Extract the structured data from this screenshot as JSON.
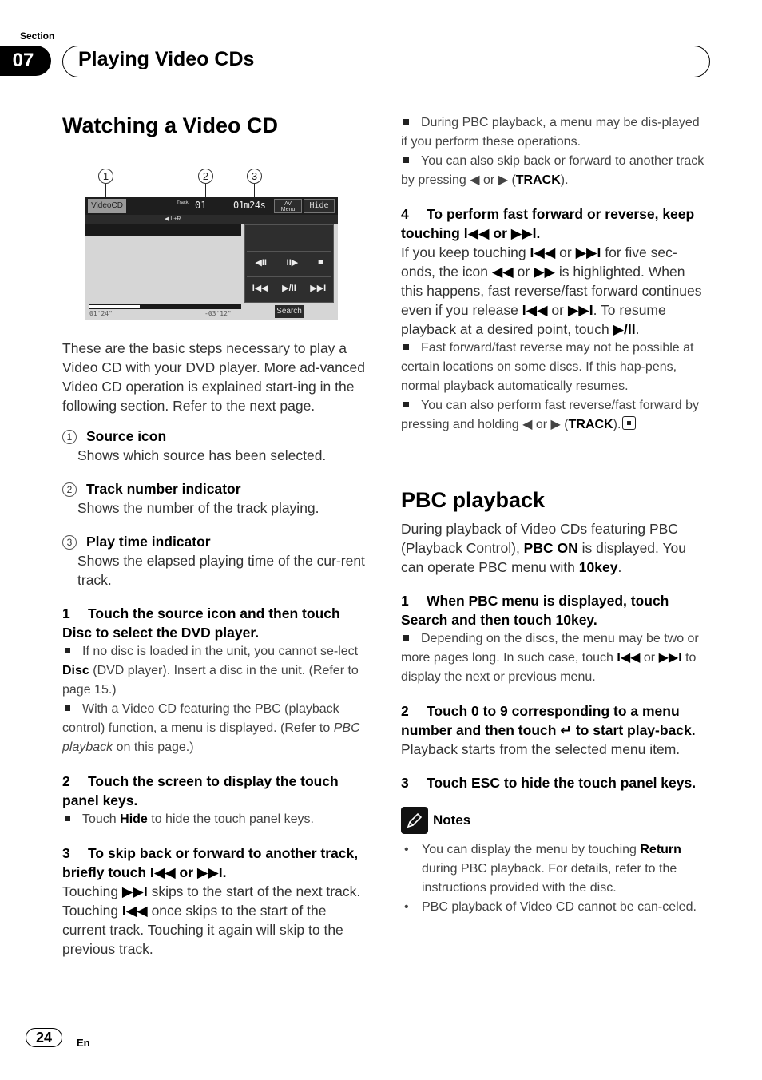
{
  "header": {
    "section_label": "Section",
    "section_number": "07",
    "section_title": "Playing Video CDs"
  },
  "left": {
    "title": "Watching a Video CD",
    "figure": {
      "callouts": [
        "1",
        "2",
        "3"
      ],
      "screen": {
        "source_button": "VideoCD",
        "track_label": "Track",
        "track_value": "01",
        "time_value": "01m24s",
        "av_menu_line1": "AV",
        "av_menu_line2": "Menu",
        "hide_button": "Hide",
        "audio_channel": "L+R",
        "controls_row1": [
          "◀II",
          "II▶",
          "■"
        ],
        "controls_row2": [
          "I◀◀",
          "▶/II",
          "▶▶I"
        ],
        "progress_fraction": 0.33,
        "elapsed_time": "01'24\"",
        "remaining_time": "-03'12\"",
        "search_button": "Search"
      }
    },
    "intro": "These are the basic steps necessary to play a Video CD with your DVD player. More ad-vanced Video CD operation is explained start-ing in the following section. Refer to the next page.",
    "items": [
      {
        "num": "1",
        "heading": "Source icon",
        "desc": "Shows which source has been selected."
      },
      {
        "num": "2",
        "heading": "Track number indicator",
        "desc": "Shows the number of the track playing."
      },
      {
        "num": "3",
        "heading": "Play time indicator",
        "desc": "Shows the elapsed playing time of the cur-rent track."
      }
    ],
    "step1": {
      "num": "1",
      "heading": "Touch the source icon and then touch Disc to select the DVD player.",
      "bullet1_a": "If no disc is loaded in the unit, you cannot se-lect ",
      "bullet1_b": "Disc",
      "bullet1_c": " (DVD player). Insert a disc in the unit. (Refer to page 15.)",
      "bullet2_a": "With a Video CD featuring the PBC (playback control) function, a menu is displayed. (Refer to ",
      "bullet2_b": "PBC playback",
      "bullet2_c": " on this page.)"
    },
    "step2": {
      "num": "2",
      "heading": "Touch the screen to display the touch panel keys.",
      "bullet_a": "Touch ",
      "bullet_b": "Hide",
      "bullet_c": " to hide the touch panel keys."
    },
    "step3": {
      "num": "3",
      "heading_a": "To skip back or forward to another track, briefly touch ",
      "heading_prev": "I◀◀",
      "heading_or": " or ",
      "heading_next": "▶▶I",
      "heading_end": ".",
      "body_a": "Touching ",
      "body_next": "▶▶I",
      "body_b": " skips to the start of the next track. Touching ",
      "body_prev": "I◀◀",
      "body_c": " once skips to the start of the current track. Touching it again will skip to the previous track."
    }
  },
  "right": {
    "top_bullet1": "During PBC playback, a menu may be dis-played if you perform these operations.",
    "top_bullet2_a": "You can also skip back or forward to another track by pressing ◀ or ▶ (",
    "top_bullet2_b": "TRACK",
    "top_bullet2_c": ").",
    "step4": {
      "num": "4",
      "heading_a": "To perform fast forward or reverse, keep touching ",
      "heading_prev": "I◀◀",
      "heading_or": " or ",
      "heading_next": "▶▶I",
      "heading_end": ".",
      "body_1": "If you keep touching ",
      "body_prev1": "I◀◀",
      "body_2": " or ",
      "body_next1": "▶▶I",
      "body_3": " for five sec-onds, the icon ",
      "body_rew": "◀◀",
      "body_4": " or ",
      "body_ff": "▶▶",
      "body_5": " is highlighted. When this happens, fast reverse/fast forward continues even if you release ",
      "body_prev2": "I◀◀",
      "body_6": " or ",
      "body_next2": "▶▶I",
      "body_7": ". To resume playback at a desired point, touch ",
      "body_play": "▶/II",
      "body_8": ".",
      "bullet1": "Fast forward/fast reverse may not be possible at certain locations on some discs. If this hap-pens, normal playback automatically resumes.",
      "bullet2_a": "You can also perform fast reverse/fast forward by pressing and holding ◀ or ▶ (",
      "bullet2_b": "TRACK",
      "bullet2_c": ")."
    },
    "pbc": {
      "title": "PBC playback",
      "intro_a": "During playback of Video CDs featuring PBC (Playback Control), ",
      "intro_b": "PBC ON",
      "intro_c": " is displayed. You can operate PBC menu with ",
      "intro_d": "10key",
      "intro_e": ".",
      "step1_num": "1",
      "step1_heading": "When PBC menu is displayed, touch Search and then touch 10key.",
      "step1_bullet_a": "Depending on the discs, the menu may be two or more pages long. In such case, touch ",
      "step1_bullet_prev": "I◀◀",
      "step1_bullet_b": " or ",
      "step1_bullet_next": "▶▶I",
      "step1_bullet_c": " to display the next or previous menu.",
      "step2_num": "2",
      "step2_heading_a": "Touch 0 to 9 corresponding to a menu number and then touch ",
      "step2_enter": "↵",
      "step2_heading_b": " to start play-back.",
      "step2_body": "Playback starts from the selected menu item.",
      "step3_num": "3",
      "step3_heading": "Touch ESC to hide the touch panel keys."
    },
    "notes": {
      "title": "Notes",
      "note1_a": "You can display the menu by touching ",
      "note1_b": "Return",
      "note1_c": " during PBC playback. For details, refer to the instructions provided with the disc.",
      "note2": "PBC playback of Video CD cannot be can-celed."
    }
  },
  "footer": {
    "page_number": "24",
    "language": "En"
  }
}
